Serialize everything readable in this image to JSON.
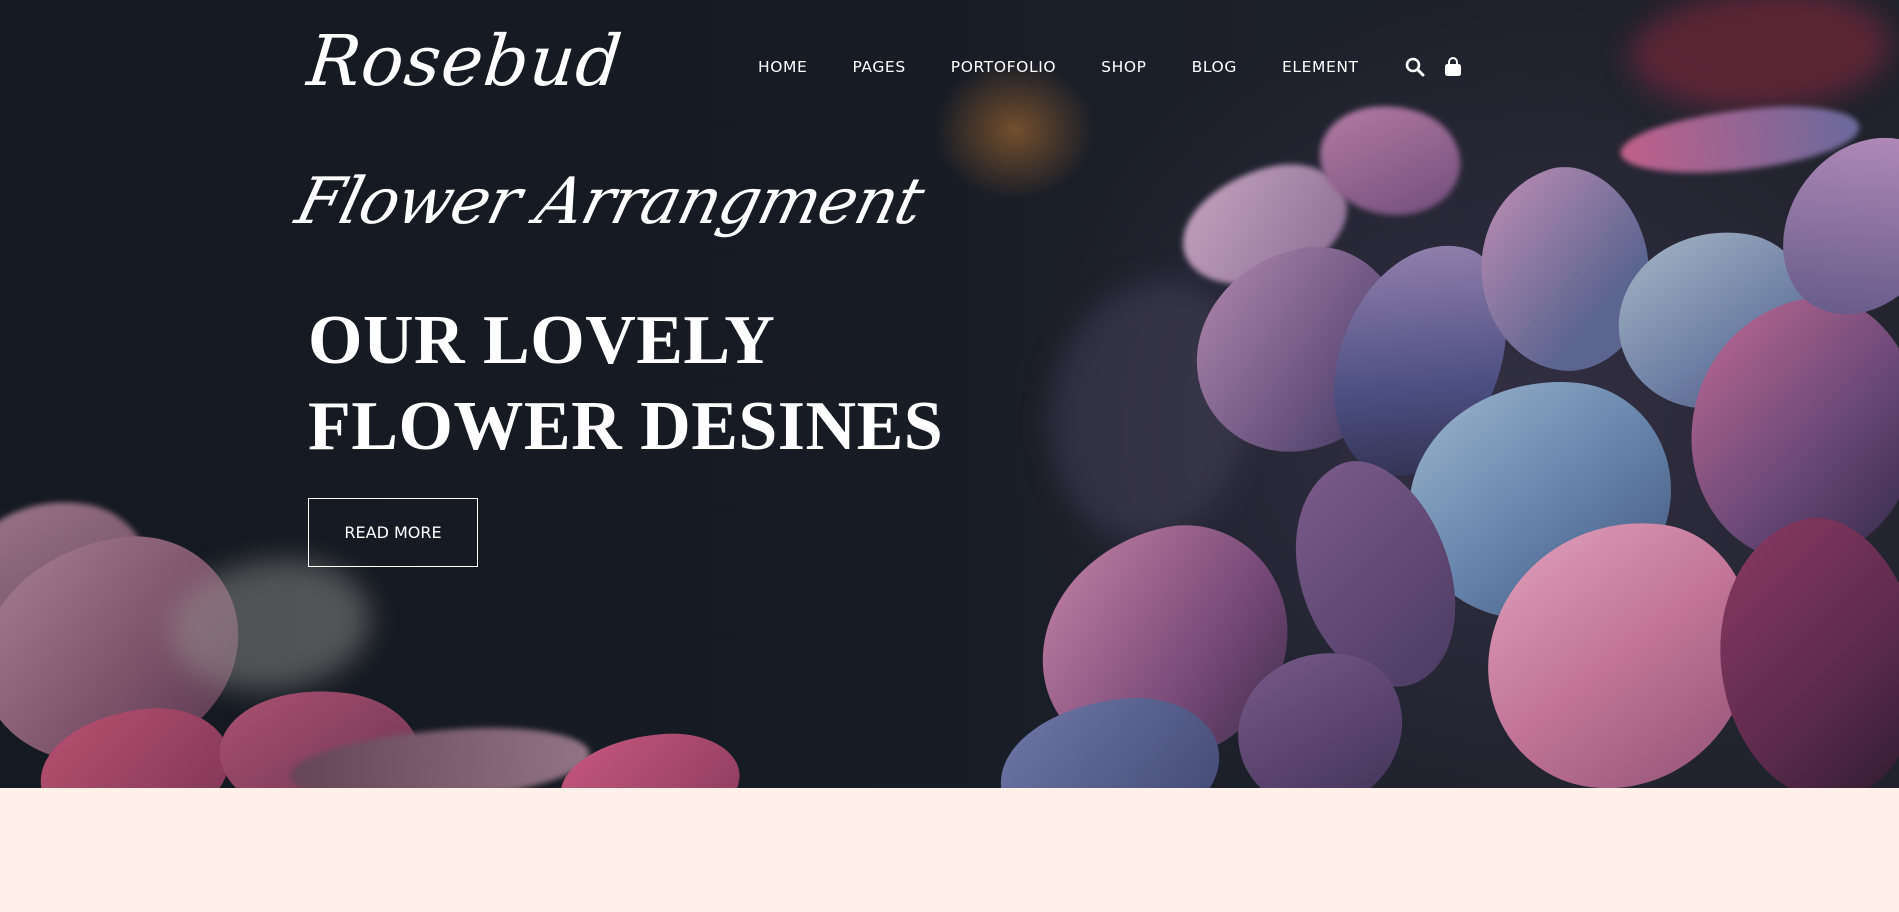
{
  "header": {
    "logo_text": "Rosebud",
    "nav": [
      {
        "label": "HOME"
      },
      {
        "label": "PAGES"
      },
      {
        "label": "PORTOFOLIO"
      },
      {
        "label": "SHOP"
      },
      {
        "label": "BLOG"
      },
      {
        "label": "ELEMENT"
      }
    ],
    "icons": [
      "search-icon",
      "shopping-bag-icon"
    ]
  },
  "hero": {
    "script_title": "Flower Arrangment",
    "headline_line1": "OUR LOVELY",
    "headline_line2": "FLOWER DESINES",
    "button_label": "READ MORE"
  },
  "colors": {
    "hero_dark": "#151a22",
    "text": "#ffffff",
    "section_bg": "#fff0ea",
    "petal_pink": "#b86a8e",
    "petal_blue": "#6a85a8",
    "petal_purple": "#6e4f7e"
  }
}
